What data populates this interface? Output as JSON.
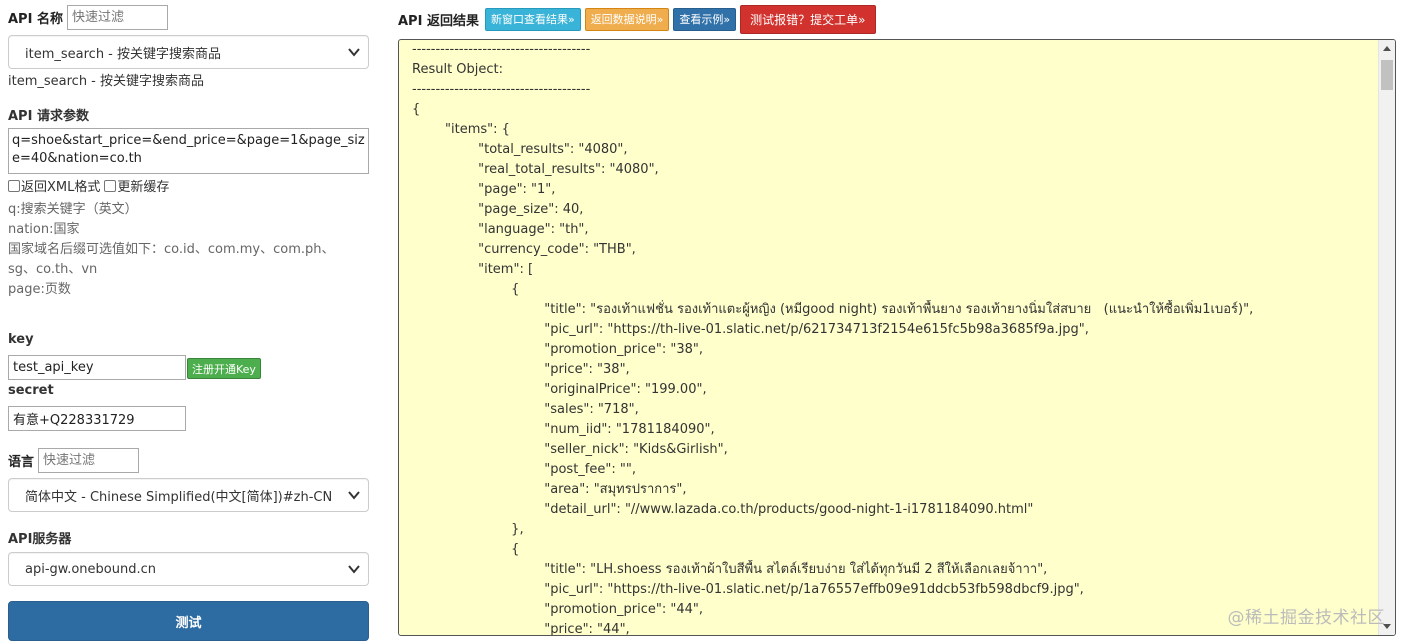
{
  "left": {
    "api_name_label": "API 名称",
    "api_filter_placeholder": "快速过滤",
    "api_select_value": "item_search - 按关键字搜索商品",
    "api_select_caption": "item_search - 按关键字搜索商品",
    "params_label": "API 请求参数",
    "params_value": "q=shoe&start_price=&end_price=&page=1&page_size=40&nation=co.th",
    "opt_xml": "返回XML格式",
    "opt_cache": "更新缓存",
    "help_lines": [
      "q:搜索关键字（英文）",
      "nation:国家",
      "国家域名后缀可选值如下：co.id、com.my、com.ph、",
      "sg、co.th、vn",
      "page:页数"
    ],
    "key_label": "key",
    "key_value": "test_api_key",
    "register_btn": "注册开通Key",
    "secret_label": "secret",
    "secret_value": "有意+Q228331729",
    "lang_label": "语言",
    "lang_filter_placeholder": "快速过滤",
    "lang_select_value": "简体中文 - Chinese Simplified(中文[简体])#zh-CN",
    "server_label": "API服务器",
    "server_select_value": "api-gw.onebound.cn",
    "test_btn": "测试"
  },
  "right": {
    "title": "API 返回结果",
    "btn_new_window": "新窗口查看结果»",
    "btn_data_desc": "返回数据说明»",
    "btn_example": "查看示例»",
    "btn_report": "测试报错？提交工单»",
    "result_lines": [
      "--------------------------------------",
      "Result Object:",
      "--------------------------------------",
      "{",
      "        \"items\": {",
      "                \"total_results\": \"4080\",",
      "                \"real_total_results\": \"4080\",",
      "                \"page\": \"1\",",
      "                \"page_size\": 40,",
      "                \"language\": \"th\",",
      "                \"currency_code\": \"THB\",",
      "                \"item\": [",
      "                        {",
      "                                \"title\": \"รองเท้าแฟชั่น รองเท้าแตะผู้หญิง (หมีgood night) รองเท้าพื้นยาง รองเท้ายางนิ่มใส่สบาย   (แนะนำให้ซื้อเพิ่ม1เบอร์)\",",
      "                                \"pic_url\": \"https://th-live-01.slatic.net/p/621734713f2154e615fc5b98a3685f9a.jpg\",",
      "                                \"promotion_price\": \"38\",",
      "                                \"price\": \"38\",",
      "                                \"originalPrice\": \"199.00\",",
      "                                \"sales\": \"718\",",
      "                                \"num_iid\": \"1781184090\",",
      "                                \"seller_nick\": \"Kids&Girlish\",",
      "                                \"post_fee\": \"\",",
      "                                \"area\": \"สมุทรปราการ\",",
      "                                \"detail_url\": \"//www.lazada.co.th/products/good-night-1-i1781184090.html\"",
      "                        },",
      "                        {",
      "                                \"title\": \"LH.shoess รองเท้าผ้าใบสีพื้น สไตล์เรียบง่าย ใส่ได้ทุกวันมี 2 สีให้เลือกเลยจ้าาา\",",
      "                                \"pic_url\": \"https://th-live-01.slatic.net/p/1a76557effb09e91ddcb53fb598dbcf9.jpg\",",
      "                                \"promotion_price\": \"44\",",
      "                                \"price\": \"44\","
    ],
    "watermark": "@稀土掘金技术社区"
  },
  "icons": {
    "select_chevron": "chevron-down-icon",
    "scroll_up": "arrow-up-icon",
    "scroll_down": "arrow-down-icon"
  }
}
